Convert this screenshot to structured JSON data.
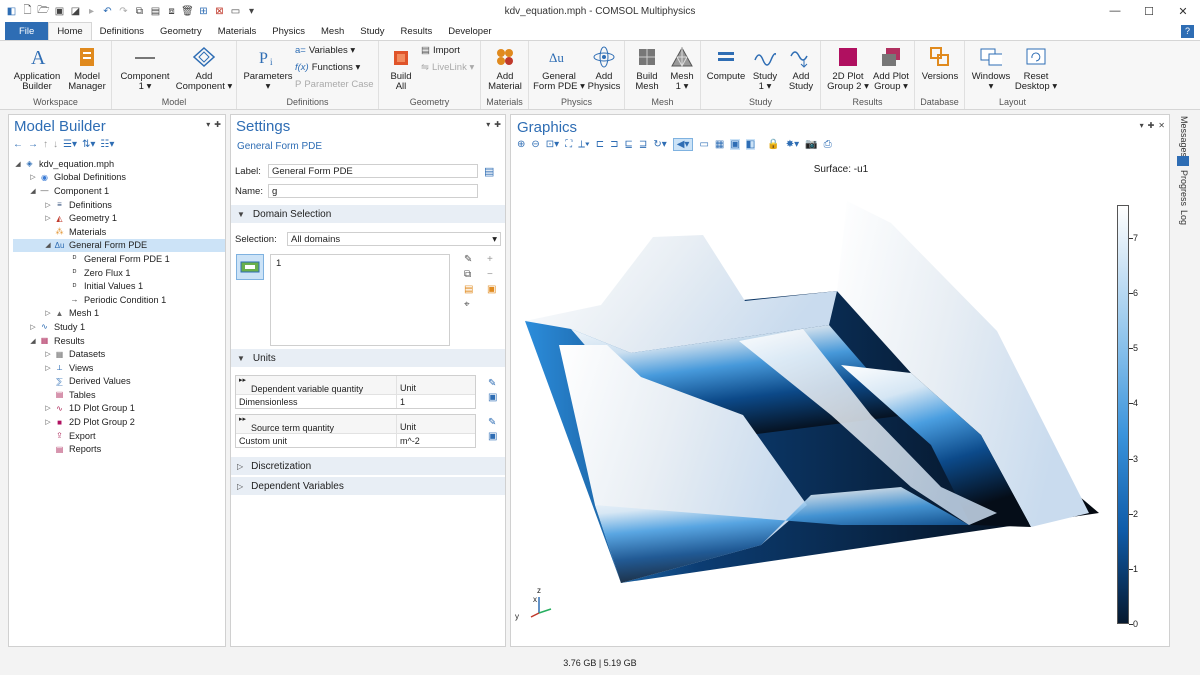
{
  "window": {
    "title": "kdv_equation.mph - COMSOL Multiphysics"
  },
  "ribbon_tabs": [
    "File",
    "Home",
    "Definitions",
    "Geometry",
    "Materials",
    "Physics",
    "Mesh",
    "Study",
    "Results",
    "Developer"
  ],
  "help_label": "?",
  "ribbon": {
    "workspace": {
      "name": "Workspace",
      "app_builder": "Application\nBuilder",
      "model_manager": "Model\nManager"
    },
    "model": {
      "name": "Model",
      "component": "Component\n1 ▾",
      "add_component": "Add\nComponent ▾"
    },
    "definitions": {
      "name": "Definitions",
      "parameters": "Parameters\n▾",
      "variables": "Variables ▾",
      "functions": "Functions ▾",
      "parameter_case": "Parameter Case"
    },
    "geometry": {
      "name": "Geometry",
      "build_all": "Build\nAll",
      "import": "Import",
      "livelink": "LiveLink ▾"
    },
    "materials": {
      "name": "Materials",
      "add_material": "Add\nMaterial"
    },
    "physics": {
      "name": "Physics",
      "general_form": "General\nForm PDE ▾",
      "add_physics": "Add\nPhysics"
    },
    "mesh": {
      "name": "Mesh",
      "build_mesh": "Build\nMesh",
      "mesh1": "Mesh\n1 ▾"
    },
    "study": {
      "name": "Study",
      "compute": "Compute",
      "study1": "Study\n1 ▾",
      "add_study": "Add\nStudy"
    },
    "results": {
      "name": "Results",
      "plot2d": "2D Plot\nGroup 2 ▾",
      "add_plot": "Add Plot\nGroup ▾"
    },
    "database": {
      "name": "Database",
      "versions": "Versions"
    },
    "layout": {
      "name": "Layout",
      "windows": "Windows\n▾",
      "reset_desktop": "Reset\nDesktop ▾"
    }
  },
  "model_builder": {
    "title": "Model Builder",
    "tree": [
      {
        "label": "kdv_equation.mph",
        "level": 0,
        "toggle": "◢",
        "icon": "mph",
        "color": "#2e6db4"
      },
      {
        "label": "Global Definitions",
        "level": 1,
        "toggle": "▷",
        "icon": "globe",
        "color": "#3a7bd5"
      },
      {
        "label": "Component 1",
        "level": 1,
        "toggle": "◢",
        "icon": "line",
        "color": "#555"
      },
      {
        "label": "Definitions",
        "level": 2,
        "toggle": "▷",
        "icon": "defs",
        "color": "#2e4d7a"
      },
      {
        "label": "Geometry 1",
        "level": 2,
        "toggle": "▷",
        "icon": "geom",
        "color": "#c0392b"
      },
      {
        "label": "Materials",
        "level": 2,
        "toggle": "",
        "icon": "mat",
        "color": "#e08a1e"
      },
      {
        "label": "General Form PDE",
        "level": 2,
        "toggle": "◢",
        "icon": "pde",
        "color": "#2e6db4",
        "selected": true
      },
      {
        "label": "General Form PDE 1",
        "level": 3,
        "toggle": "",
        "icon": "d",
        "color": "#333"
      },
      {
        "label": "Zero Flux 1",
        "level": 3,
        "toggle": "",
        "icon": "d",
        "color": "#333"
      },
      {
        "label": "Initial Values 1",
        "level": 3,
        "toggle": "",
        "icon": "d",
        "color": "#333"
      },
      {
        "label": "Periodic Condition 1",
        "level": 3,
        "toggle": "",
        "icon": "arrow",
        "color": "#333"
      },
      {
        "label": "Mesh 1",
        "level": 2,
        "toggle": "▷",
        "icon": "mesh",
        "color": "#666"
      },
      {
        "label": "Study 1",
        "level": 1,
        "toggle": "▷",
        "icon": "study",
        "color": "#2e6db4"
      },
      {
        "label": "Results",
        "level": 1,
        "toggle": "◢",
        "icon": "results",
        "color": "#b03060"
      },
      {
        "label": "Datasets",
        "level": 2,
        "toggle": "▷",
        "icon": "grid",
        "color": "#777"
      },
      {
        "label": "Views",
        "level": 2,
        "toggle": "▷",
        "icon": "axes",
        "color": "#2e6db4"
      },
      {
        "label": "Derived Values",
        "level": 2,
        "toggle": "",
        "icon": "derived",
        "color": "#2e6db4"
      },
      {
        "label": "Tables",
        "level": 2,
        "toggle": "",
        "icon": "table",
        "color": "#b03060"
      },
      {
        "label": "1D Plot Group 1",
        "level": 2,
        "toggle": "▷",
        "icon": "plot1d",
        "color": "#b03060"
      },
      {
        "label": "2D Plot Group 2",
        "level": 2,
        "toggle": "▷",
        "icon": "plot2d",
        "color": "#b01060"
      },
      {
        "label": "Export",
        "level": 2,
        "toggle": "",
        "icon": "export",
        "color": "#b03060"
      },
      {
        "label": "Reports",
        "level": 2,
        "toggle": "",
        "icon": "report",
        "color": "#b03060"
      }
    ]
  },
  "settings": {
    "title": "Settings",
    "subtitle": "General Form PDE",
    "label_caption": "Label:",
    "label_value": "General Form PDE",
    "name_caption": "Name:",
    "name_value": "g",
    "domain_selection": "Domain Selection",
    "selection_caption": "Selection:",
    "selection_value": "All domains",
    "domain_list": [
      "1"
    ],
    "units": "Units",
    "dep_table": {
      "header": "Dependent variable quantity",
      "unit_header": "Unit",
      "value": "Dimensionless",
      "unit": "1"
    },
    "src_table": {
      "header": "Source term quantity",
      "unit_header": "Unit",
      "value": "Custom unit",
      "unit": "m^-2"
    },
    "discretization": "Discretization",
    "dependent_variables": "Dependent Variables"
  },
  "graphics": {
    "title": "Graphics",
    "plot_title": "Surface: -u1",
    "colorbar_ticks": [
      "7",
      "6",
      "5",
      "4",
      "3",
      "2",
      "1",
      "0"
    ],
    "colorbar_range": [
      0,
      7.6
    ],
    "triad": {
      "z": "z",
      "x": "x",
      "y": "y"
    }
  },
  "side_tabs": [
    "Messages",
    "Progress",
    "Log"
  ],
  "status": {
    "memory": "3.76 GB | 5.19 GB"
  }
}
